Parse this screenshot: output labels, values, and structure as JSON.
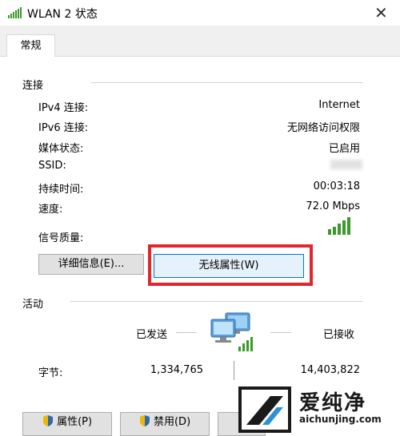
{
  "window": {
    "title": "WLAN 2 状态",
    "close_glyph": "✕"
  },
  "tabs": [
    {
      "label": "常规"
    }
  ],
  "connection": {
    "group_title": "连接",
    "rows": [
      {
        "label": "IPv4 连接:",
        "value": "Internet"
      },
      {
        "label": "IPv6 连接:",
        "value": "无网络访问权限"
      },
      {
        "label": "媒体状态:",
        "value": "已启用"
      },
      {
        "label": "SSID:",
        "value": ""
      },
      {
        "label": "持续时间:",
        "value": "00:03:18"
      },
      {
        "label": "速度:",
        "value": "72.0 Mbps"
      }
    ],
    "signal_label": "信号质量:",
    "signal_bars": 5,
    "details_button": "详细信息(E)...",
    "wireless_props_button": "无线属性(W)"
  },
  "activity": {
    "group_title": "活动",
    "sent_label": "已发送",
    "received_label": "已接收",
    "bytes_label": "字节:",
    "bytes_sent": "1,334,765",
    "bytes_received": "14,403,822"
  },
  "buttons": {
    "properties": "属性(P)",
    "disable": "禁用(D)"
  },
  "watermark": {
    "title": "爱纯净",
    "site": "aichunjing.com"
  },
  "colors": {
    "highlight_box": "#e1262c",
    "signal_green": "#3a9a2a",
    "focus_blue": "#0078d7"
  }
}
